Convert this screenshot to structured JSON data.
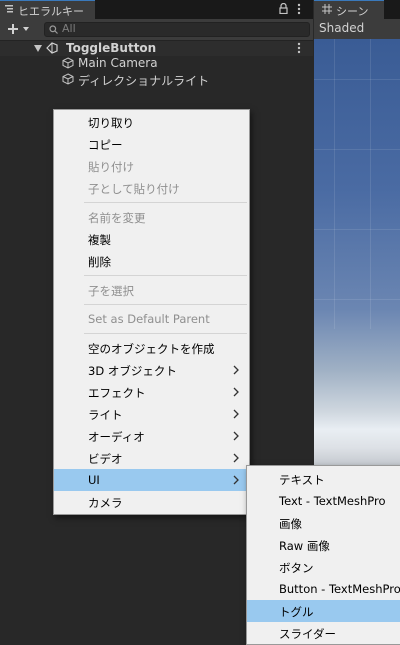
{
  "hierarchy": {
    "tab_label": "ヒエラルキー",
    "search_placeholder": "All",
    "scene_name": "ToggleButton",
    "children": [
      "Main Camera",
      "ディレクショナルライト"
    ]
  },
  "scene_view": {
    "tab_label": "シーン",
    "shading_mode": "Shaded"
  },
  "context_menu": {
    "items": [
      {
        "label": "切り取り",
        "enabled": true
      },
      {
        "label": "コピー",
        "enabled": true
      },
      {
        "label": "貼り付け",
        "enabled": false
      },
      {
        "label": "子として貼り付け",
        "enabled": false
      },
      {
        "label": "名前を変更",
        "enabled": false
      },
      {
        "label": "複製",
        "enabled": true
      },
      {
        "label": "削除",
        "enabled": true
      },
      {
        "label": "子を選択",
        "enabled": false
      },
      {
        "label": "Set as Default Parent",
        "enabled": false
      },
      {
        "label": "空のオブジェクトを作成",
        "enabled": true
      },
      {
        "label": "3D オブジェクト",
        "enabled": true,
        "submenu": true
      },
      {
        "label": "エフェクト",
        "enabled": true,
        "submenu": true
      },
      {
        "label": "ライト",
        "enabled": true,
        "submenu": true
      },
      {
        "label": "オーディオ",
        "enabled": true,
        "submenu": true
      },
      {
        "label": "ビデオ",
        "enabled": true,
        "submenu": true
      },
      {
        "label": "UI",
        "enabled": true,
        "submenu": true,
        "highlighted": true
      },
      {
        "label": "カメラ",
        "enabled": true
      }
    ]
  },
  "ui_submenu": {
    "items": [
      {
        "label": "テキスト"
      },
      {
        "label": "Text - TextMeshPro"
      },
      {
        "label": "画像"
      },
      {
        "label": "Raw 画像"
      },
      {
        "label": "ボタン"
      },
      {
        "label": "Button - TextMeshPro"
      },
      {
        "label": "トグル",
        "highlighted": true
      },
      {
        "label": "スライダー"
      }
    ]
  },
  "colors": {
    "highlight": "#99c9ef",
    "menu_background": "#f0f0f0",
    "panel_background": "#282828",
    "tab_accent": "#3a79bb"
  }
}
